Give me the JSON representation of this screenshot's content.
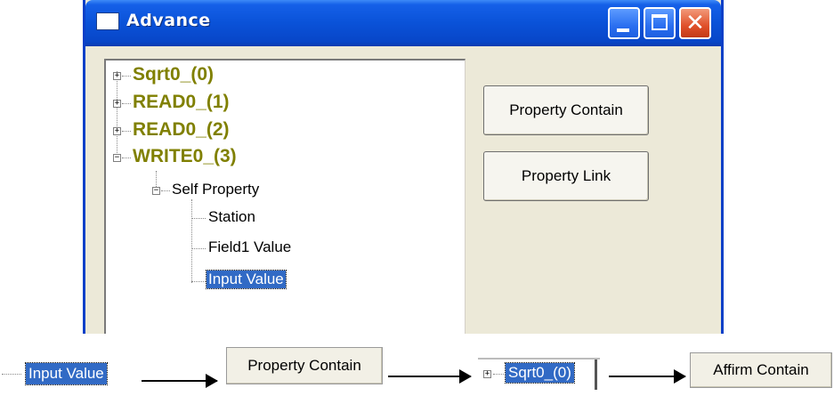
{
  "window": {
    "title": "Advance"
  },
  "tree": {
    "items": [
      {
        "label": "Sqrt0_(0)",
        "expander": "+"
      },
      {
        "label": "READ0_(1)",
        "expander": "+"
      },
      {
        "label": "READ0_(2)",
        "expander": "+"
      },
      {
        "label": "WRITE0_(3)",
        "expander": "−"
      }
    ],
    "group": {
      "label": "Self Property",
      "expander": "−"
    },
    "children": [
      {
        "label": "Station"
      },
      {
        "label": "Field1 Value"
      },
      {
        "label": "Input Value",
        "selected": true
      }
    ]
  },
  "buttons": {
    "property_contain": "Property Contain",
    "property_link": "Property Link"
  },
  "flow": {
    "step1": "Input Value",
    "step2": "Property Contain",
    "step3": "Sqrt0_(0)",
    "step4": "Affirm Contain"
  },
  "colors": {
    "titlebar": "#0a52d8",
    "window_bg": "#ece9d8",
    "tree_bold_text": "#808000",
    "selection": "#316ac5",
    "close_button": "#e0502a"
  },
  "icons": {
    "expand": "plus-box-icon",
    "collapse": "minus-box-icon",
    "window": "window-icon"
  }
}
